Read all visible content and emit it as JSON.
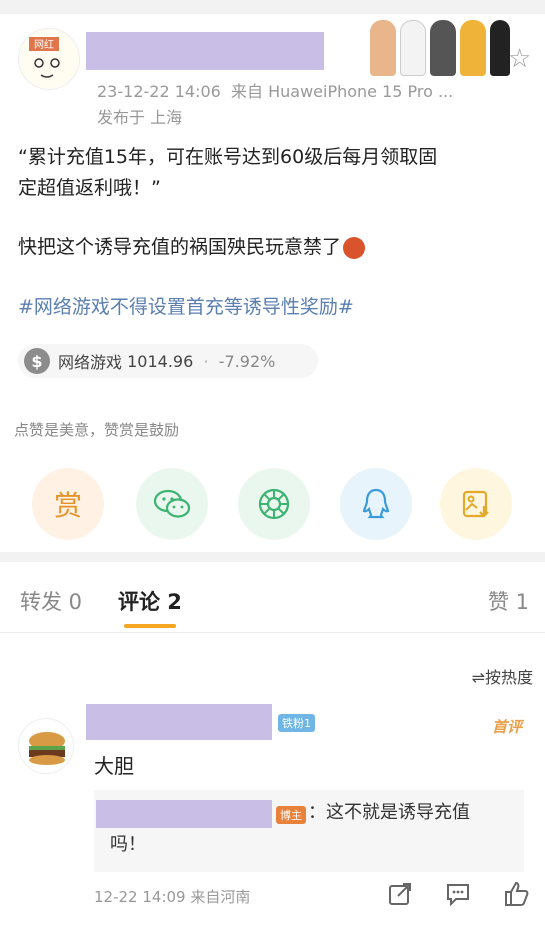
{
  "post": {
    "avatar_badge": "网红",
    "meta": "23-12-22 14:06",
    "meta_source": "来自 HuaweiPhone 15 Pro ...",
    "location": "发布于 上海",
    "body_line1": "“累计充值15年，可在账号达到60级后每月领取固",
    "body_line2": "定超值返利哦！”",
    "body_line3": "快把这个诱导充值的祸国殃民玩意禁了",
    "hashtag": "#网络游戏不得设置首充等诱导性奖励#",
    "stock": {
      "name": "网络游戏",
      "value": "1014.96",
      "sep": "·",
      "change": "-7.92%"
    },
    "reward_hint": "点赞是美意，赞赏是鼓励",
    "reward_button": "赏"
  },
  "tabs": {
    "repost": "转发 0",
    "comment": "评论 2",
    "like": "赞 1"
  },
  "comments": {
    "sort_label": "按热度",
    "first": {
      "badge": "铁粉1",
      "first_label": "首评",
      "text": "大胆",
      "reply": {
        "badge": "博主",
        "text_line1": "：这不就是诱导充值",
        "text_line2": "吗！"
      },
      "time": "12-22 14:09",
      "location": "来自河南"
    }
  },
  "colors": {
    "accent": "#f5a623",
    "hashtag": "#5b7fb0",
    "redacted": "#c9bfe6"
  }
}
